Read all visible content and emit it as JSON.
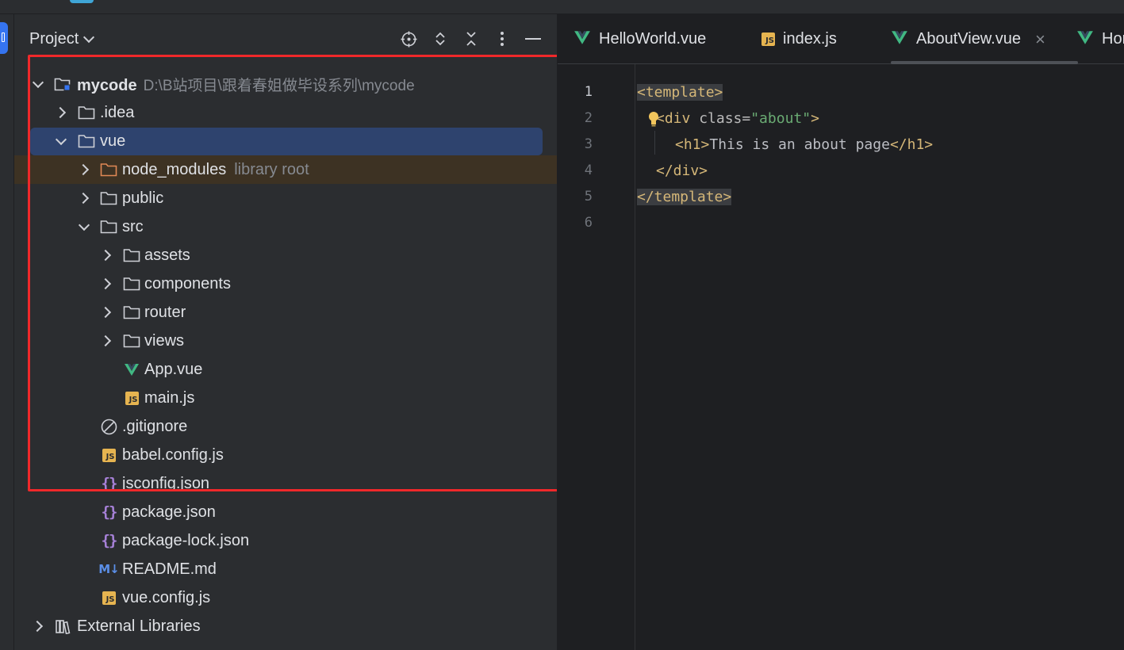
{
  "colors": {
    "folder": "#ced0d6",
    "node_modules_folder": "#e08855",
    "vue_green": "#41b883",
    "js_badge": "#e6b450",
    "json_icon": "#a781d8",
    "selection": "#2e436e",
    "library_row": "#3d3223",
    "highlight_box": "#f0282a",
    "tag": "#d5b778",
    "string": "#6aab73"
  },
  "project_panel": {
    "title": "Project",
    "actions": [
      {
        "icon": "locate-icon"
      },
      {
        "icon": "expand-all-icon"
      },
      {
        "icon": "collapse-all-icon"
      },
      {
        "icon": "more-options-icon"
      },
      {
        "icon": "minimize-icon"
      }
    ],
    "tree": [
      {
        "name": "mycode",
        "path": "D:\\B站项目\\跟着春姐做毕设系列\\mycode",
        "icon": "module-folder-icon",
        "level": 0,
        "state": "expanded"
      },
      {
        "name": ".idea",
        "icon": "folder-icon",
        "level": 1,
        "state": "collapsed"
      },
      {
        "name": "vue",
        "icon": "folder-icon",
        "level": 1,
        "state": "expanded",
        "selected": true
      },
      {
        "name": "node_modules",
        "hint": "library root",
        "icon": "folder-icon",
        "level": 2,
        "state": "collapsed"
      },
      {
        "name": "public",
        "icon": "folder-icon",
        "level": 2,
        "state": "collapsed"
      },
      {
        "name": "src",
        "icon": "folder-icon",
        "level": 2,
        "state": "expanded"
      },
      {
        "name": "assets",
        "icon": "folder-icon",
        "level": 3,
        "state": "collapsed"
      },
      {
        "name": "components",
        "icon": "folder-icon",
        "level": 3,
        "state": "collapsed"
      },
      {
        "name": "router",
        "icon": "folder-icon",
        "level": 3,
        "state": "collapsed"
      },
      {
        "name": "views",
        "icon": "folder-icon",
        "level": 3,
        "state": "collapsed"
      },
      {
        "name": "App.vue",
        "icon": "vue-file-icon",
        "level": 3
      },
      {
        "name": "main.js",
        "icon": "js-file-icon",
        "level": 3
      },
      {
        "name": ".gitignore",
        "icon": "ignore-file-icon",
        "level": 2
      },
      {
        "name": "babel.config.js",
        "icon": "js-file-icon",
        "level": 2
      },
      {
        "name": "jsconfig.json",
        "icon": "json-file-icon",
        "level": 2
      },
      {
        "name": "package.json",
        "icon": "json-file-icon",
        "level": 2
      },
      {
        "name": "package-lock.json",
        "icon": "json-file-icon",
        "level": 2
      },
      {
        "name": "README.md",
        "icon": "markdown-file-icon",
        "level": 2
      },
      {
        "name": "vue.config.js",
        "icon": "js-file-icon",
        "level": 2
      },
      {
        "name": "External Libraries",
        "icon": "library-icon",
        "level": 0,
        "state": "collapsed"
      }
    ]
  },
  "editor": {
    "tabs": [
      {
        "label": "HelloWorld.vue",
        "icon": "vue-file-icon"
      },
      {
        "label": "index.js",
        "icon": "js-file-icon"
      },
      {
        "label": "AboutView.vue",
        "icon": "vue-file-icon",
        "active": true,
        "close": "×"
      },
      {
        "label": "Hor",
        "icon": "vue-file-icon"
      }
    ],
    "line_numbers": [
      "1",
      "2",
      "3",
      "4",
      "5",
      "6"
    ],
    "current_line": "1",
    "code": {
      "l1_tag": "<template>",
      "l2_open": "<div ",
      "l2_attr": "class=",
      "l2_str": "\"about\"",
      "l2_close": ">",
      "l3_open": "<h1>",
      "l3_text": "This is an about page",
      "l3_close": "</h1>",
      "l4_tag": "</div>",
      "l5_tag": "</template>"
    }
  }
}
